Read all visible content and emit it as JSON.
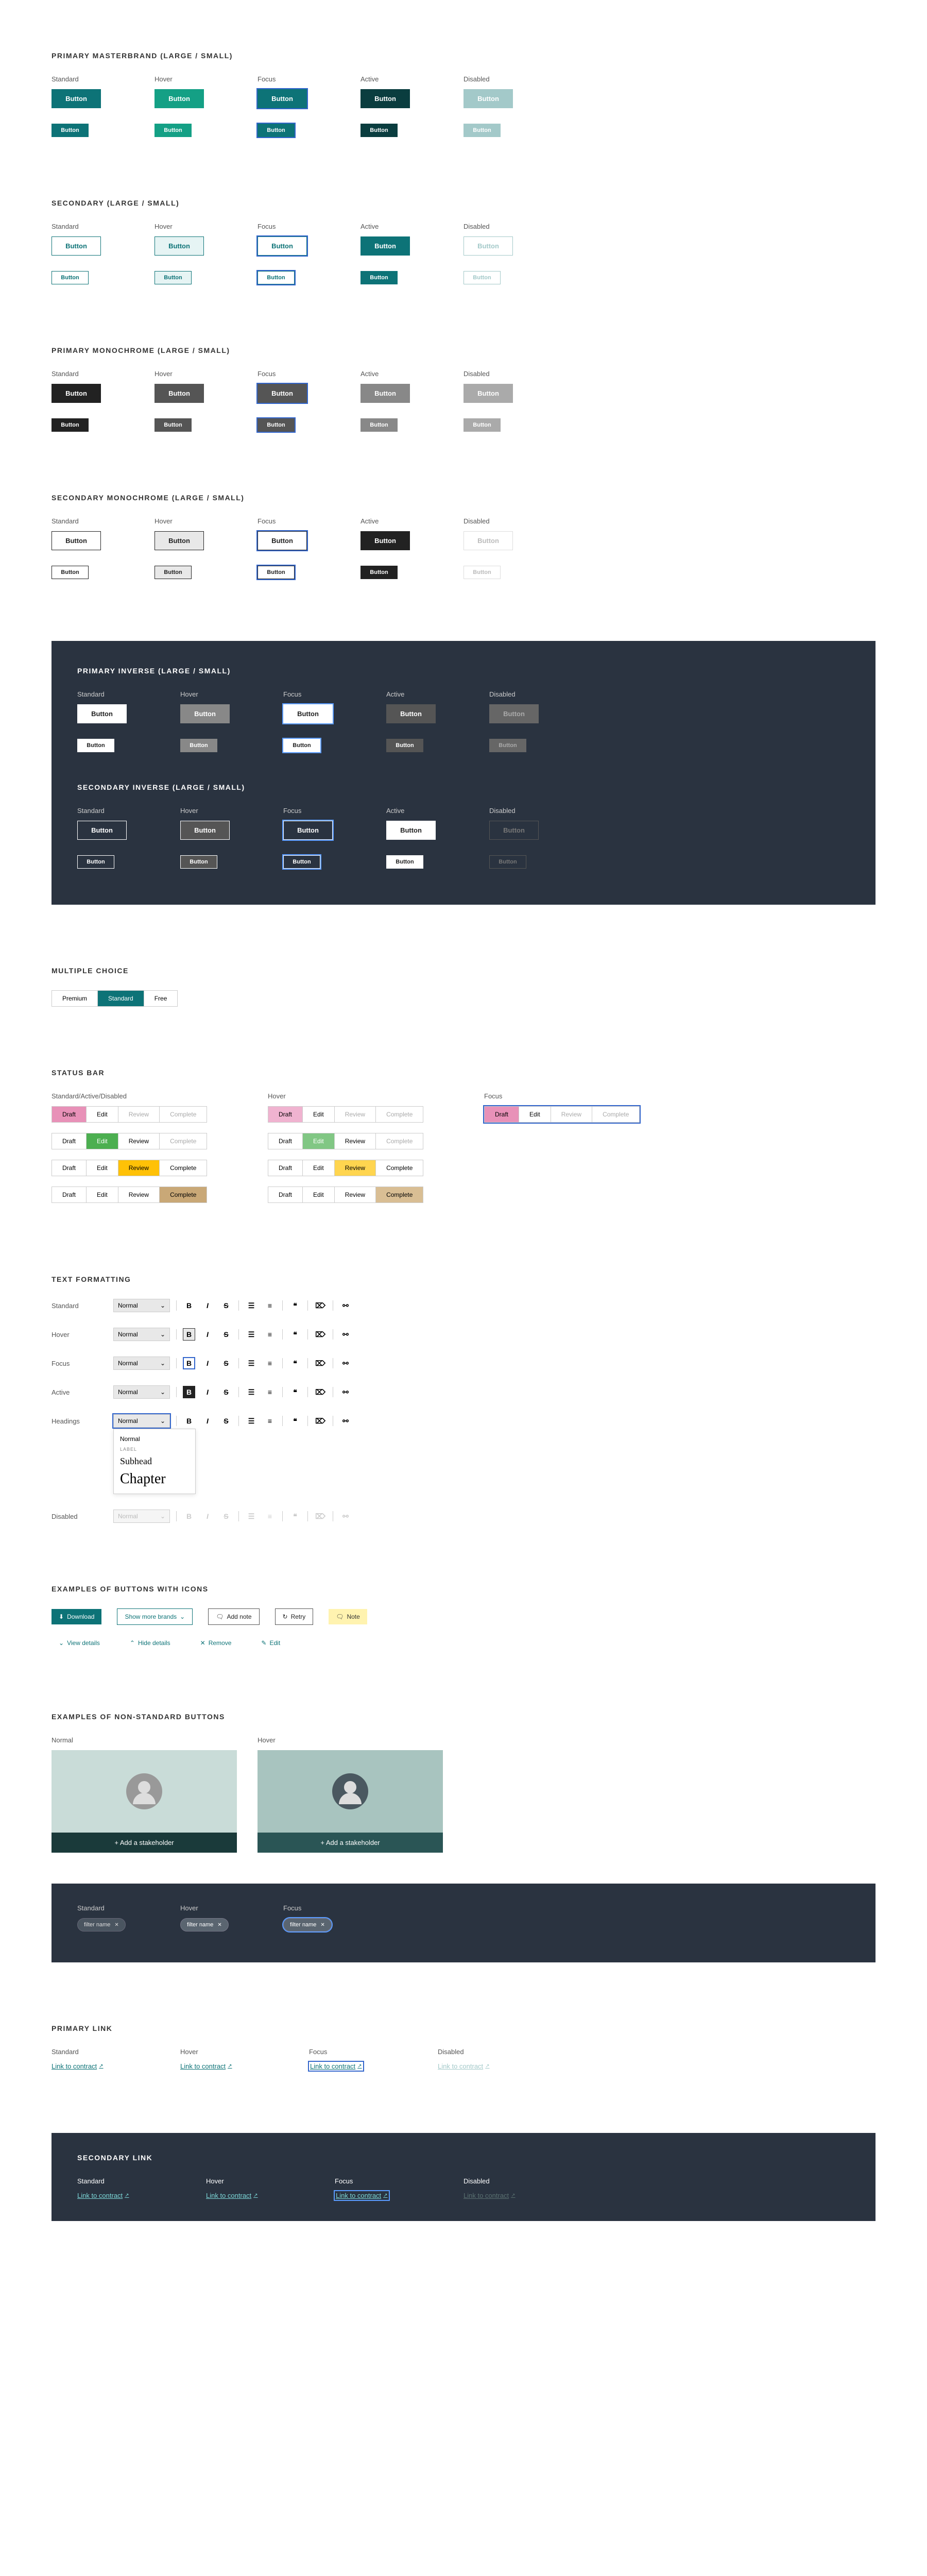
{
  "states": [
    "Standard",
    "Hover",
    "Focus",
    "Active",
    "Disabled"
  ],
  "button_label": "Button",
  "sections": {
    "primary_masterbrand": "PRIMARY MASTERBRAND (LARGE / SMALL)",
    "secondary": "SECONDARY (LARGE / SMALL)",
    "primary_monochrome": "PRIMARY MONOCHROME (LARGE / SMALL)",
    "secondary_monochrome": "SECONDARY MONOCHROME (LARGE / SMALL)",
    "primary_inverse": "PRIMARY INVERSE (LARGE / SMALL)",
    "secondary_inverse": "SECONDARY INVERSE (LARGE / SMALL)",
    "multiple_choice": "MULTIPLE CHOICE",
    "status_bar": "STATUS BAR",
    "text_formatting": "TEXT FORMATTING",
    "buttons_icons": "EXAMPLES OF BUTTONS WITH ICONS",
    "nonstandard": "EXAMPLES OF NON-STANDARD BUTTONS",
    "primary_link": "PRIMARY LINK",
    "secondary_link": "SECONDARY LINK"
  },
  "multiple_choice": {
    "items": [
      "Premium",
      "Standard",
      "Free"
    ],
    "active": 1
  },
  "status_bar": {
    "header_sad": "Standard/Active/Disabled",
    "header_hover": "Hover",
    "header_focus": "Focus",
    "steps": [
      "Draft",
      "Edit",
      "Review",
      "Complete"
    ]
  },
  "text_formatting": {
    "rows": [
      "Standard",
      "Hover",
      "Focus",
      "Active",
      "Headings",
      "Disabled"
    ],
    "select_value": "Normal",
    "dropdown": {
      "label": "LABEL",
      "normal": "Normal",
      "subhead": "Subhead",
      "chapter": "Chapter"
    }
  },
  "icon_buttons": {
    "download": "Download",
    "show_more": "Show more brands",
    "add_note": "Add note",
    "retry": "Retry",
    "note": "Note",
    "view_details": "View details",
    "hide_details": "Hide details",
    "remove": "Remove",
    "edit": "Edit"
  },
  "nonstandard": {
    "normal": "Normal",
    "hover": "Hover",
    "add_stakeholder": "Add a stakeholder"
  },
  "chip": {
    "label": "filter name"
  },
  "link": {
    "text": "Link to contract"
  }
}
